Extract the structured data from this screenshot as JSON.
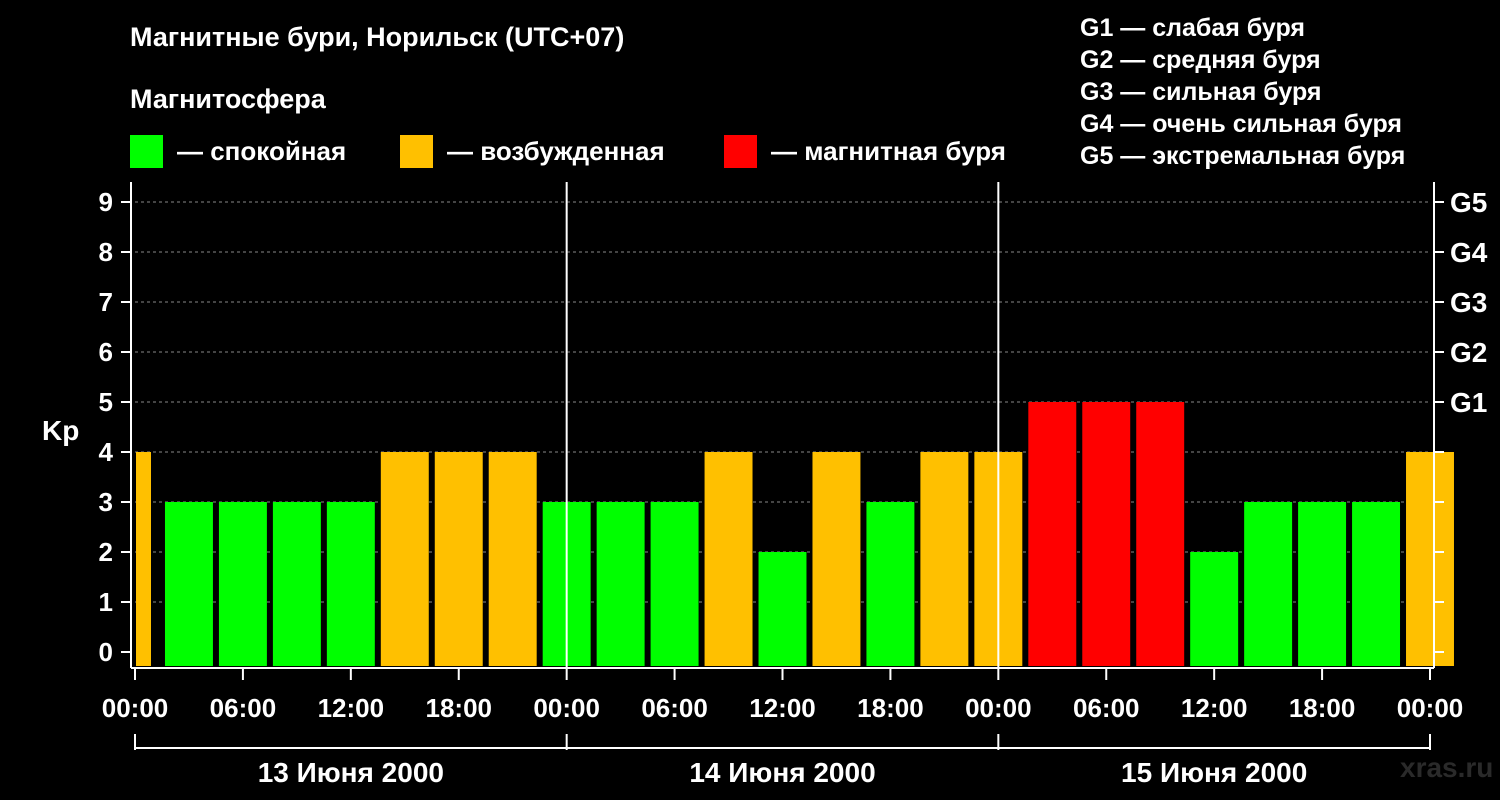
{
  "title": "Магнитные бури, Норильск (UTC+07)",
  "subtitle": "Магнитосфера",
  "legend": [
    {
      "label": "— спокойная",
      "color": "#00ff00"
    },
    {
      "label": "— возбужденная",
      "color": "#ffc000"
    },
    {
      "label": "— магнитная буря",
      "color": "#ff0000"
    }
  ],
  "g_legend": [
    "G1 — слабая буря",
    "G2 — средняя буря",
    "G3 — сильная буря",
    "G4 — очень сильная буря",
    "G5 — экстремальная буря"
  ],
  "watermark": "xras.ru",
  "colors": {
    "quiet": "#00ff00",
    "disturbed": "#ffc000",
    "storm": "#ff0000",
    "background": "#000000",
    "axis": "#ffffff"
  },
  "chart_data": {
    "type": "bar",
    "ylabel": "Kp",
    "ylim": [
      0,
      9
    ],
    "yticks": [
      "0",
      "1",
      "2",
      "3",
      "4",
      "5",
      "6",
      "7",
      "8",
      "9"
    ],
    "right_axis": [
      {
        "label": "G1",
        "kp": 5
      },
      {
        "label": "G2",
        "kp": 6
      },
      {
        "label": "G3",
        "kp": 7
      },
      {
        "label": "G4",
        "kp": 8
      },
      {
        "label": "G5",
        "kp": 9
      }
    ],
    "xtick_labels": [
      "00:00",
      "06:00",
      "12:00",
      "18:00",
      "00:00",
      "06:00",
      "12:00",
      "18:00",
      "00:00",
      "06:00",
      "12:00",
      "18:00",
      "00:00"
    ],
    "days": [
      "13 Июня 2000",
      "14 Июня 2000",
      "15 Июня 2000"
    ],
    "x_range_hours": [
      0,
      72
    ],
    "bar_interval_hours": 3,
    "values": [
      3,
      3,
      3,
      3,
      4,
      4,
      4,
      3,
      3,
      3,
      4,
      2,
      4,
      3,
      4,
      4,
      5,
      5,
      5,
      2,
      3,
      3,
      3,
      4
    ],
    "status": [
      "quiet",
      "quiet",
      "quiet",
      "quiet",
      "disturbed",
      "disturbed",
      "disturbed",
      "quiet",
      "quiet",
      "quiet",
      "disturbed",
      "quiet",
      "disturbed",
      "quiet",
      "disturbed",
      "disturbed",
      "storm",
      "storm",
      "storm",
      "quiet",
      "quiet",
      "quiet",
      "quiet",
      "disturbed"
    ],
    "leading_bar": {
      "value": 4,
      "status": "disturbed"
    },
    "grid": "dashed horizontal"
  }
}
